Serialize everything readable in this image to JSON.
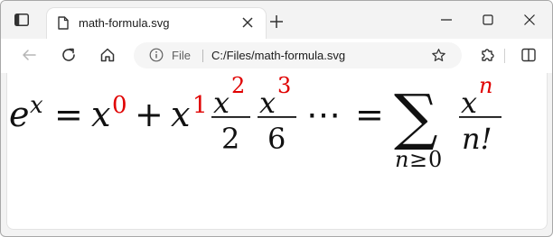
{
  "tab": {
    "title": "math-formula.svg"
  },
  "address": {
    "scheme_label": "File",
    "url": "C:/Files/math-formula.svg"
  },
  "colors": {
    "accent_red": "#e00000",
    "formula_black": "#111111"
  },
  "icons": {
    "window_menu": "window-icon",
    "tab_doc": "document-icon",
    "tab_close": "close-icon",
    "new_tab": "plus-icon",
    "minimize": "minimize-icon",
    "maximize": "maximize-icon",
    "close": "close-icon",
    "back": "back-arrow-icon",
    "reload": "reload-icon",
    "home": "home-icon",
    "info": "info-icon",
    "favorite": "star-icon",
    "extensions": "puzzle-icon",
    "split": "split-screen-icon"
  },
  "formula": {
    "e": "e",
    "x": "x",
    "eq": "=",
    "plus": "+",
    "dots": "⋯",
    "sum": "∑",
    "exp0": "0",
    "exp1": "1",
    "exp2": "2",
    "exp3": "3",
    "expn": "n",
    "den2": "2",
    "den6": "6",
    "den_nfact": "n!",
    "sub_n": "n",
    "sub_geq": "≥",
    "sub_0": "0"
  }
}
